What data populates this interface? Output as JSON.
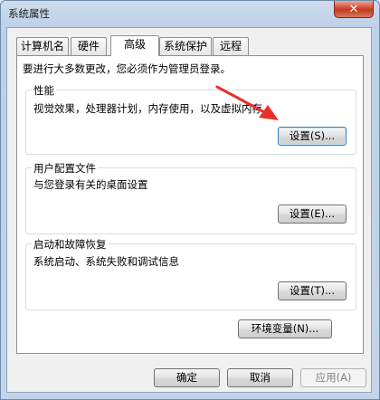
{
  "window": {
    "title": "系统属性",
    "close_glyph": "✕"
  },
  "tabs": [
    {
      "label": "计算机名"
    },
    {
      "label": "硬件"
    },
    {
      "label": "高级"
    },
    {
      "label": "系统保护"
    },
    {
      "label": "远程"
    }
  ],
  "notice": "要进行大多数更改，您必须作为管理员登录。",
  "groups": {
    "performance": {
      "title": "性能",
      "desc": "视觉效果，处理器计划，内存使用，以及虚拟内存",
      "button": "设置(S)..."
    },
    "user_profiles": {
      "title": "用户配置文件",
      "desc": "与您登录有关的桌面设置",
      "button": "设置(E)..."
    },
    "startup_recovery": {
      "title": "启动和故障恢复",
      "desc": "系统启动、系统失败和调试信息",
      "button": "设置(T)..."
    }
  },
  "env_button": "环境变量(N)...",
  "footer": {
    "ok": "确定",
    "cancel": "取消",
    "apply": "应用(A)"
  },
  "colors": {
    "arrow": "#e8302a"
  }
}
